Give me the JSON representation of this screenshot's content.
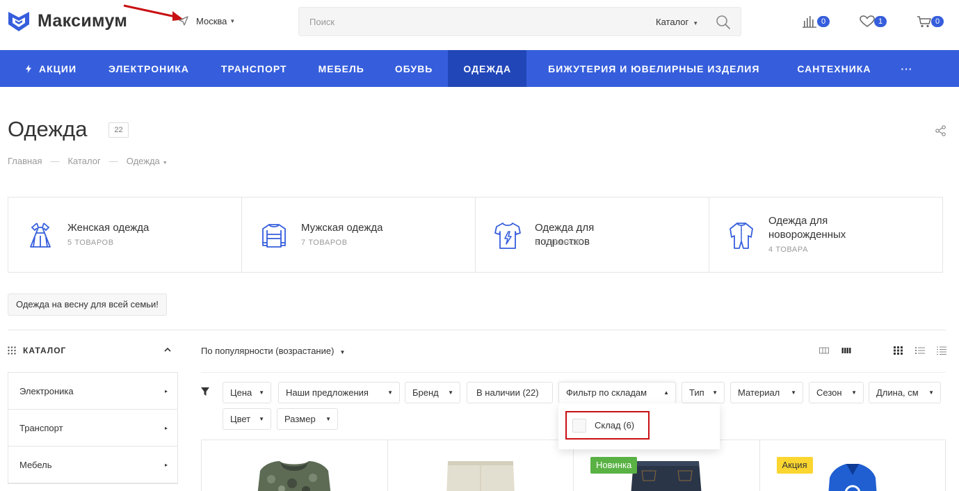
{
  "header": {
    "logo_text": "Максимум",
    "city": "Москва",
    "search_placeholder": "Поиск",
    "search_scope": "Каталог",
    "compare_count": "0",
    "favorites_count": "1",
    "cart_count": "0"
  },
  "nav": [
    {
      "label": "Акции"
    },
    {
      "label": "Электроника"
    },
    {
      "label": "Транспорт"
    },
    {
      "label": "Мебель"
    },
    {
      "label": "Обувь"
    },
    {
      "label": "Одежда"
    },
    {
      "label": "Бижутерия и ювелирные изделия"
    },
    {
      "label": "Сантехника"
    },
    {
      "label": "···"
    }
  ],
  "page": {
    "title": "Одежда",
    "count": "22",
    "breadcrumb": [
      "Главная",
      "Каталог",
      "Одежда"
    ]
  },
  "categories": [
    {
      "name": "Женская одежда",
      "count": "5 товаров",
      "icon": "dress-icon"
    },
    {
      "name": "Мужская одежда",
      "count": "7 товаров",
      "icon": "sweater-icon"
    },
    {
      "name": "Одежда для подростков",
      "count": "6 товаров",
      "icon": "tshirt-icon"
    },
    {
      "name": "Одежда для новорожденных",
      "count": "4 товара",
      "icon": "onesie-icon"
    }
  ],
  "tag": "Одежда на весну для всей семьи!",
  "sidebar": {
    "title": "Каталог",
    "items": [
      {
        "label": "Электроника"
      },
      {
        "label": "Транспорт"
      },
      {
        "label": "Мебель"
      }
    ]
  },
  "sort": "По популярности (возрастание)",
  "filters": [
    {
      "label": "Цена"
    },
    {
      "label": "Наши предложения"
    },
    {
      "label": "Бренд"
    },
    {
      "label": "В наличии (22)"
    },
    {
      "label": "Фильтр по складам"
    },
    {
      "label": "Тип"
    },
    {
      "label": "Материал"
    },
    {
      "label": "Сезон"
    },
    {
      "label": "Длина, см"
    },
    {
      "label": "Цвет"
    },
    {
      "label": "Размер"
    }
  ],
  "warehouse_option": "Склад (6)",
  "products": [
    {
      "badge": ""
    },
    {
      "badge": ""
    },
    {
      "badge": "Новинка"
    },
    {
      "badge": "Акция"
    }
  ],
  "colors": {
    "accent": "#365edc",
    "nav_active": "#2146b8",
    "highlight": "#c81013",
    "new_badge": "#5ab245",
    "sale_badge": "#fbd530"
  }
}
